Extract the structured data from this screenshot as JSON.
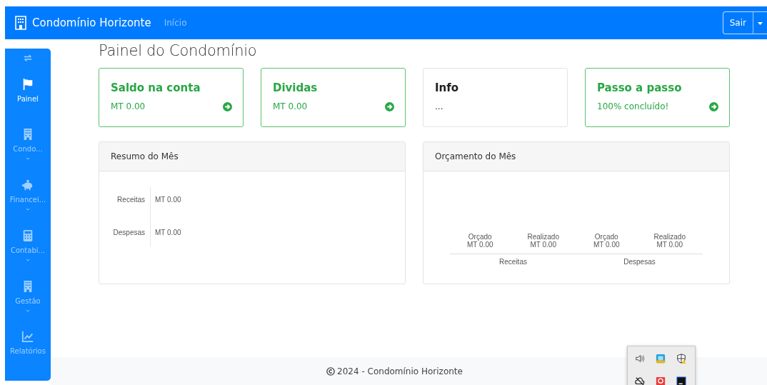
{
  "navbar": {
    "brand": "Condomínio Horizonte",
    "link": "Início",
    "logout": "Sair"
  },
  "sidebar": {
    "items": [
      {
        "label": "Painel",
        "kind": "flag",
        "selected": true,
        "has_submenu": false
      },
      {
        "label": "Condo...",
        "kind": "building",
        "selected": false,
        "has_submenu": true
      },
      {
        "label": "Financei...",
        "kind": "piggy",
        "selected": false,
        "has_submenu": true
      },
      {
        "label": "Contabi...",
        "kind": "calculator",
        "selected": false,
        "has_submenu": true
      },
      {
        "label": "Gestão",
        "kind": "building",
        "selected": false,
        "has_submenu": true
      },
      {
        "label": "Relatórios",
        "kind": "chart",
        "selected": false,
        "has_submenu": false
      }
    ]
  },
  "page_title": "Painel do Condomínio",
  "cards": [
    {
      "title": "Saldo na conta",
      "value": "MT 0.00",
      "highlighted": true,
      "has_link": true
    },
    {
      "title": "Dividas",
      "value": "MT 0.00",
      "highlighted": true,
      "has_link": true
    },
    {
      "title": "Info",
      "value": "...",
      "highlighted": false,
      "has_link": false
    },
    {
      "title": "Passo a passo",
      "value": "100% concluído!",
      "highlighted": true,
      "has_link": true
    }
  ],
  "summary": {
    "title": "Resumo do Mês",
    "rows": [
      {
        "label": "Receitas",
        "value": "MT 0.00"
      },
      {
        "label": "Despesas",
        "value": "MT 0.00"
      }
    ]
  },
  "budget": {
    "title": "Orçamento do Mês",
    "groups": [
      {
        "name": "Receitas",
        "columns": [
          {
            "label": "Orçado",
            "value": "MT 0.00"
          },
          {
            "label": "Realizado",
            "value": "MT 0.00"
          }
        ]
      },
      {
        "name": "Despesas",
        "columns": [
          {
            "label": "Orçado",
            "value": "MT 0.00"
          },
          {
            "label": "Realizado",
            "value": "MT 0.00"
          }
        ]
      }
    ]
  },
  "footer": {
    "text": "2024 - Condomínio Horizonte"
  },
  "tray_popup": {
    "icons": [
      {
        "kind": "speaker"
      },
      {
        "kind": "app-blue"
      },
      {
        "kind": "shield-warning"
      },
      {
        "kind": "cloud-off"
      },
      {
        "kind": "app-red"
      },
      {
        "kind": "app-dark"
      }
    ]
  }
}
